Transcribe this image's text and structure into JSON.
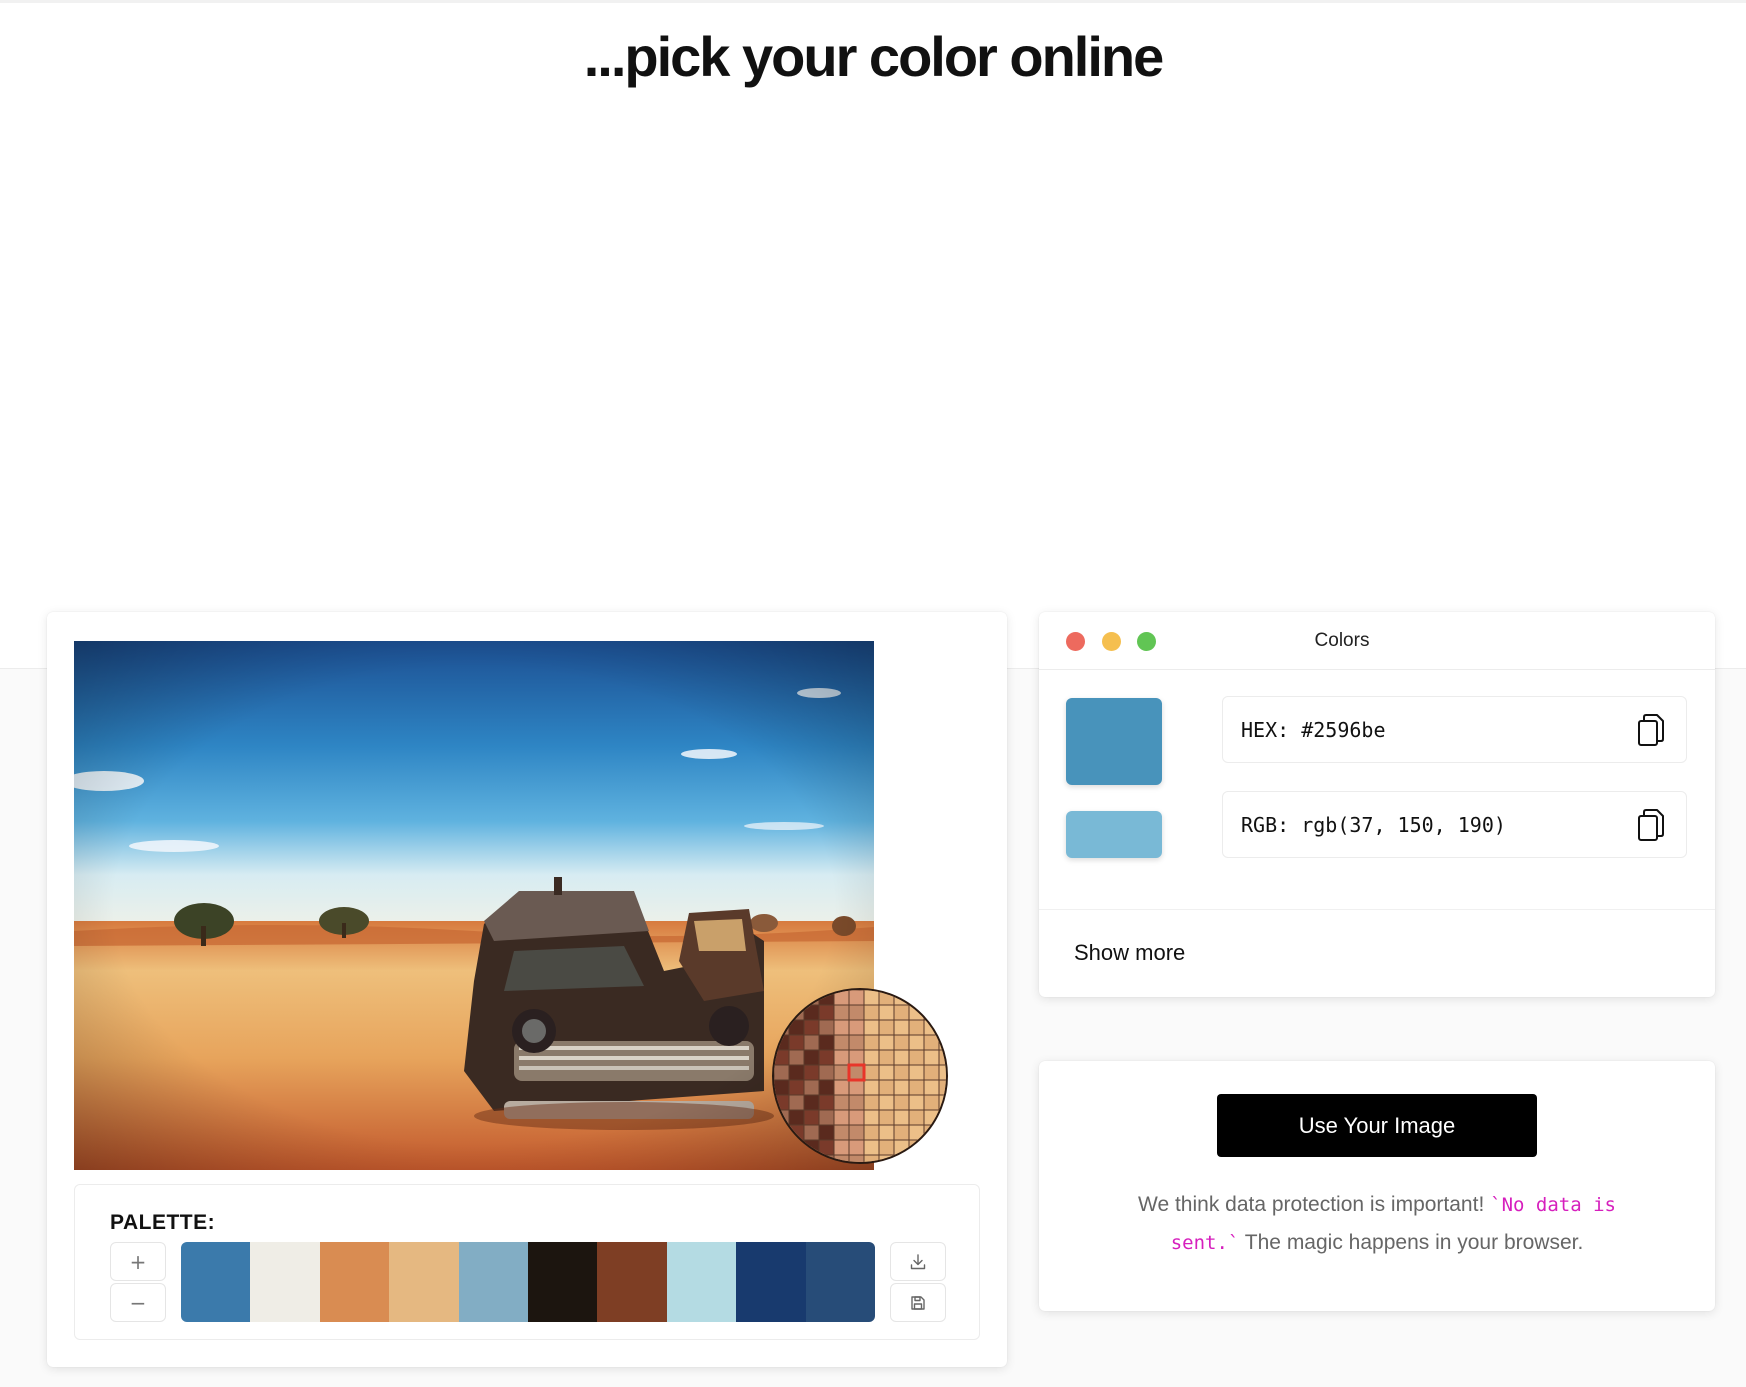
{
  "page": {
    "title": "...pick your color online"
  },
  "picker": {
    "palette_label": "PALETTE:",
    "add_icon": "plus-icon",
    "remove_icon": "minus-icon",
    "download_icon": "download-icon",
    "save_icon": "save-icon",
    "palette_colors": [
      "#3b7aab",
      "#efede6",
      "#d98c52",
      "#e5b881",
      "#82adc4",
      "#1c150f",
      "#7e3e24",
      "#b4dbe3",
      "#183a6e",
      "#274c78"
    ]
  },
  "colors_panel": {
    "title": "Colors",
    "window_dots": [
      "#ed6a5e",
      "#f5bf4f",
      "#61c554"
    ],
    "primary_swatch": "#4893bb",
    "secondary_swatch": "#79b9d6",
    "hex_label": "HEX:",
    "hex_value": "#2596be",
    "rgb_label": "RGB:",
    "rgb_value": "rgb(37, 150, 190)",
    "copy_icon": "copy-icon",
    "show_more": "Show more"
  },
  "upload": {
    "button_label": "Use Your Image",
    "privacy_text_1": "We think data protection is important!",
    "privacy_code_1": "`No data is",
    "privacy_code_2": "sent.`",
    "privacy_text_2": "The magic happens in your browser."
  }
}
